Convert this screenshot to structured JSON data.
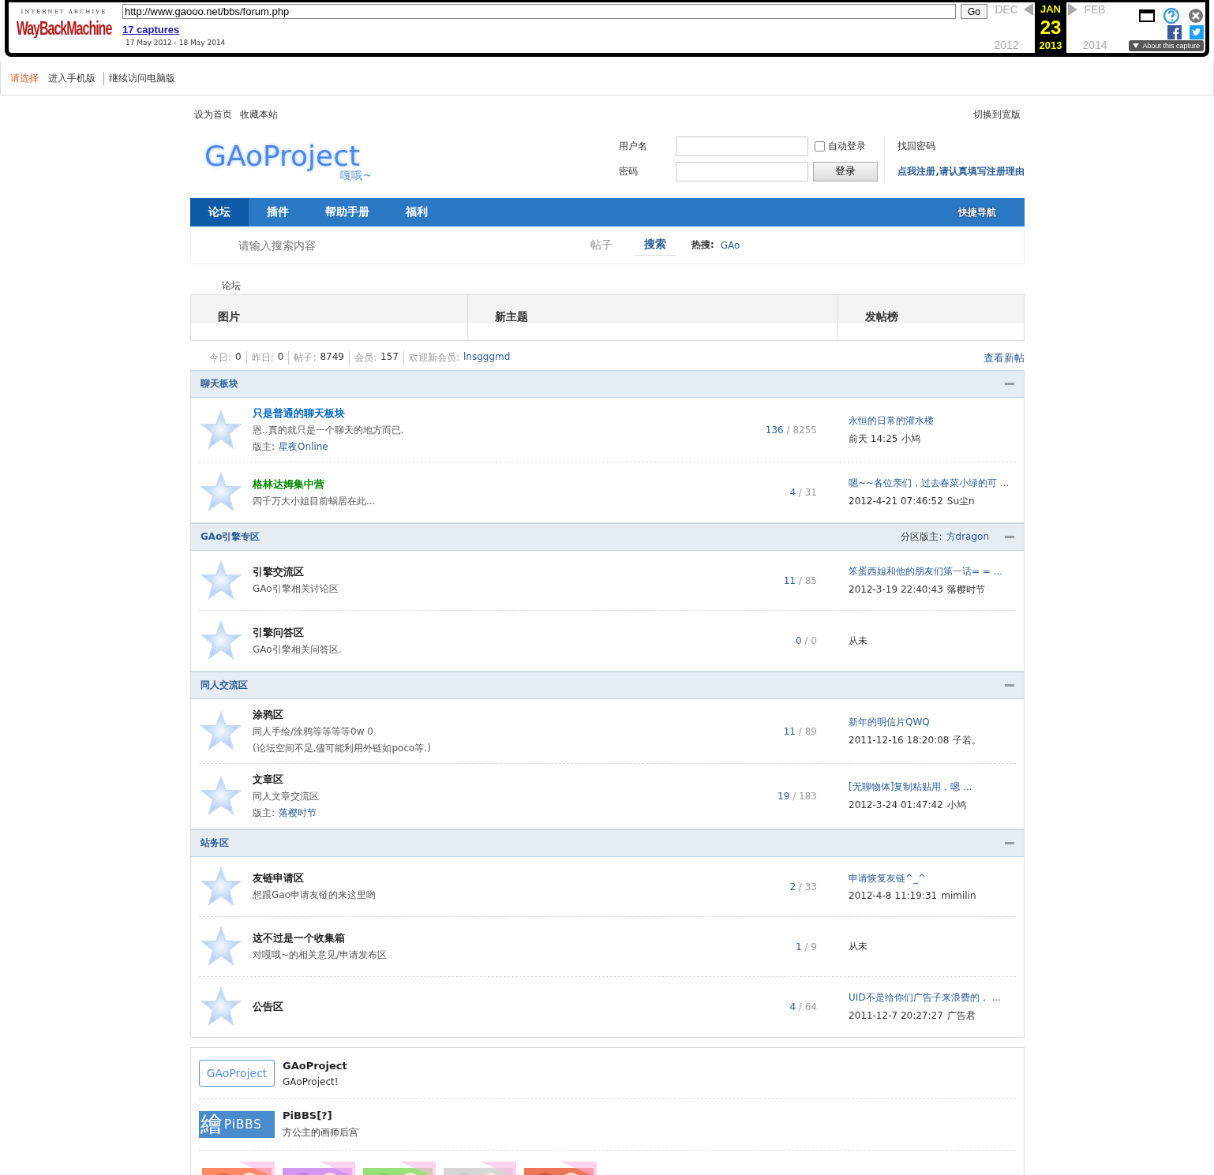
{
  "wayback": {
    "logo_top": "INTERNET ARCHIVE",
    "logo_main": "WayBackMachine",
    "url": "http://www.gaooo.net/bbs/forum.php",
    "go": "Go",
    "captures": "17 captures",
    "range": "17 May 2012 - 18 May 2014",
    "about": "About this capture",
    "months": [
      {
        "month": "DEC",
        "year": "2012",
        "selected": false
      },
      {
        "month": "JAN",
        "day": "23",
        "year": "2013",
        "selected": true
      },
      {
        "month": "FEB",
        "year": "2014",
        "selected": false
      }
    ]
  },
  "mobile_bar": {
    "prompt": "请选择",
    "links": [
      "进入手机版",
      "继续访问电脑版"
    ]
  },
  "topbar": {
    "left": [
      "设为首页",
      "收藏本站"
    ],
    "right": "切换到宽版"
  },
  "header": {
    "logo": {
      "title": "GAoProject",
      "subtitle": "嘎哦~"
    },
    "login": {
      "username_label": "用户名",
      "password_label": "密码",
      "auto_login": {
        "label": "自动登录",
        "checked": false
      },
      "button": "登录",
      "forgot": "找回密码",
      "register": "点我注册,请认真填写注册理由"
    }
  },
  "nav": {
    "items": [
      {
        "label": "论坛",
        "selected": true
      },
      {
        "label": "插件",
        "selected": false
      },
      {
        "label": "帮助手册",
        "selected": false
      },
      {
        "label": "福利",
        "selected": false
      }
    ],
    "quick_nav": "快捷导航"
  },
  "search": {
    "placeholder": "请输入搜索内容",
    "type": "帖子",
    "button": "搜索",
    "hot_label": "热搜:",
    "hot": [
      "GAo"
    ]
  },
  "breadcrumb": "论坛",
  "panels": [
    "图片",
    "新主题",
    "发帖榜"
  ],
  "stats": {
    "items": [
      {
        "label": "今日:",
        "value": "0"
      },
      {
        "label": "昨日:",
        "value": "0"
      },
      {
        "label": "帖子:",
        "value": "8749"
      },
      {
        "label": "会员:",
        "value": "157"
      }
    ],
    "welcome": "欢迎新会员:",
    "new_member": "lnsgggmd",
    "view_new": "查看新帖"
  },
  "categories": [
    {
      "title": "聊天板块",
      "forums": [
        {
          "name": "只是普通的聊天板块",
          "color": "#0066cc",
          "desc": [
            "恩..真的就只是一个聊天的地方而已."
          ],
          "moderator_label": "版主:",
          "moderator": "星夜Online",
          "threads": "136",
          "posts": "8255",
          "last": {
            "kind": "post",
            "title": "永恒的日常的灌水楼",
            "time": "前天 14:25",
            "user": "小鸠"
          }
        },
        {
          "name": "格林达姆集中营",
          "color": "#008800",
          "desc": [
            "四千万大小姐目前蜗居在此..."
          ],
          "threads": "4",
          "posts": "31",
          "last": {
            "kind": "post",
            "title": "嗯~~各位亲们，过去春菜小绿的可 ...",
            "time": "2012-4-21 07:46:52",
            "user": "Su尘n"
          }
        }
      ]
    },
    {
      "title": "GAo引擎专区",
      "moderator_label": "分区版主:",
      "moderator": "方dragon",
      "forums": [
        {
          "name": "引擎交流区",
          "color": "#222222",
          "desc": [
            "GAo引擎相关讨论区"
          ],
          "threads": "11",
          "posts": "85",
          "last": {
            "kind": "post",
            "title": "笨蛋西姐和他的朋友们第一话= = ...",
            "time": "2012-3-19 22:40:43",
            "user": "落樱时节"
          }
        },
        {
          "name": "引擎问答区",
          "color": "#222222",
          "desc": [
            "GAo引擎相关问答区."
          ],
          "threads": "0",
          "posts": "0",
          "last": {
            "kind": "never",
            "text": "从未"
          }
        }
      ]
    },
    {
      "title": "同人交流区",
      "forums": [
        {
          "name": "涂鸦区",
          "color": "#222222",
          "desc": [
            "同人手绘/涂鸦等等等等0w 0",
            "(论坛空间不足,儘可能利用外链如poco等.)"
          ],
          "threads": "11",
          "posts": "89",
          "last": {
            "kind": "post",
            "title": "新年的明信片QWQ",
            "time": "2011-12-16 18:20:08",
            "user": "子若。"
          }
        },
        {
          "name": "文章区",
          "color": "#222222",
          "desc": [
            "同人文章交流区"
          ],
          "moderator_label": "版主:",
          "moderator": "落樱时节",
          "threads": "19",
          "posts": "183",
          "last": {
            "kind": "post",
            "title": "[无聊物体]复制粘贴用，嗯 ...",
            "time": "2012-3-24 01:47:42",
            "user": "小鸠"
          }
        }
      ]
    },
    {
      "title": "站务区",
      "forums": [
        {
          "name": "友链申请区",
          "color": "#222222",
          "desc": [
            "想跟Gao申请友链的来这里哟"
          ],
          "threads": "2",
          "posts": "33",
          "last": {
            "kind": "post",
            "title": "申请恢复友链^_^",
            "time": "2012-4-8 11:19:31",
            "user": "mimilin"
          }
        },
        {
          "name": "这不过是一个收集箱",
          "color": "#222222",
          "desc": [
            "对嘎哦~的相关意见/申请发布区"
          ],
          "threads": "1",
          "posts": "9",
          "last": {
            "kind": "never",
            "text": "从未"
          }
        },
        {
          "name": "公告区",
          "color": "#222222",
          "threads": "4",
          "posts": "64",
          "last": {
            "kind": "post",
            "title": "UID不是给你们广告子来浪费的， ...",
            "time": "2011-12-7 20:27:27",
            "user": "广告君"
          }
        }
      ]
    }
  ],
  "friend_links": [
    {
      "name": "GAoProject",
      "desc": "GAoProject!",
      "logo": {
        "kind": "outline",
        "text": "GAoProject"
      }
    },
    {
      "name": "PiBBS[?]",
      "desc": "方公主的画师后宫",
      "logo": {
        "kind": "solid",
        "mark": "繪",
        "text": "PiBBS"
      }
    }
  ],
  "count_separator": "/",
  "banners": [
    {
      "kind": "picture"
    },
    {
      "kind": "picture"
    },
    {
      "kind": "picture"
    },
    {
      "kind": "picture"
    },
    {
      "kind": "picture"
    }
  ]
}
